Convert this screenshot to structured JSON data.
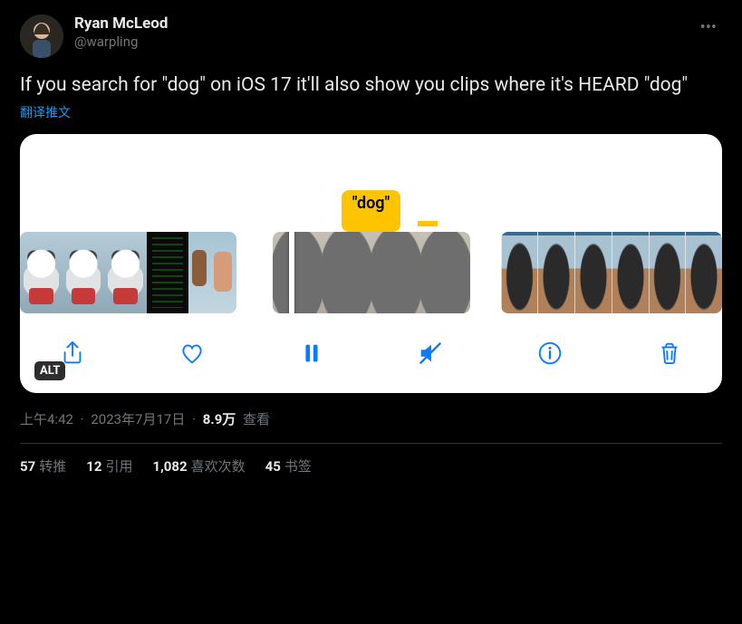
{
  "author": {
    "display_name": "Ryan McLeod",
    "handle": "@warpling"
  },
  "body_text": "If you search for \"dog\" on iOS 17 it'll also show you clips where it's HEARD \"dog\"",
  "translate_label": "翻译推文",
  "media": {
    "search_pill": "\"dog\"",
    "alt_badge": "ALT"
  },
  "meta": {
    "time": "上午4:42",
    "date": "2023年7月17日",
    "views_number": "8.9万",
    "views_label": "查看"
  },
  "stats": {
    "retweets_num": "57",
    "retweets_label": "转推",
    "quotes_num": "12",
    "quotes_label": "引用",
    "likes_num": "1,082",
    "likes_label": "喜欢次数",
    "bookmarks_num": "45",
    "bookmarks_label": "书签"
  }
}
